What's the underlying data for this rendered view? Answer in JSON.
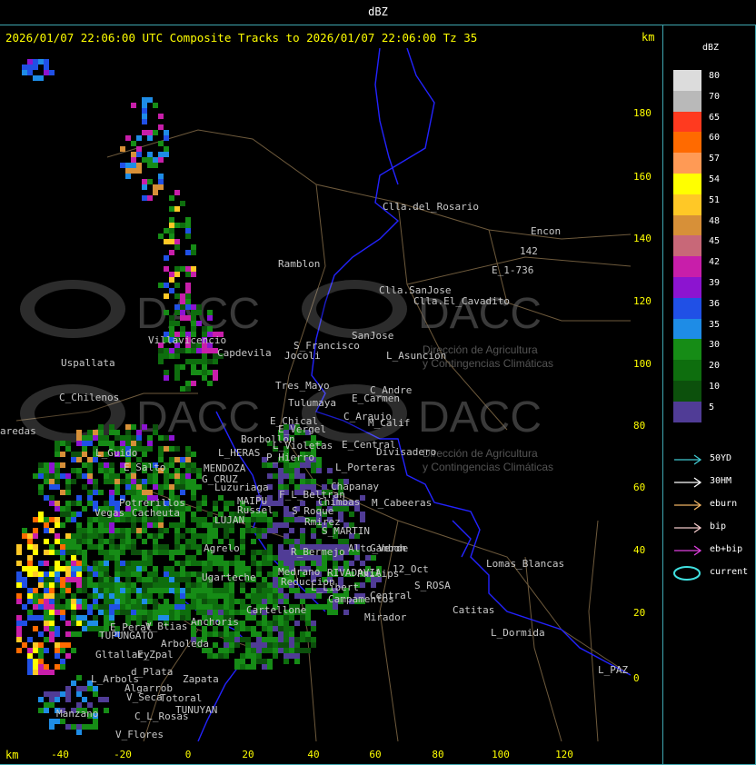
{
  "window": {
    "title": "dBZ"
  },
  "header": {
    "line": "2026/01/07 22:06:00 UTC Composite Tracks to 2026/01/07 22:06:00 Tz 35",
    "km_label_top": "km",
    "km_label_bottom": "km"
  },
  "axes": {
    "y_ticks": [
      "180",
      "160",
      "140",
      "120",
      "100",
      "80",
      "60",
      "40",
      "20",
      "0"
    ],
    "x_ticks": [
      "-40",
      "-20",
      "0",
      "20",
      "40",
      "60",
      "80",
      "100",
      "120"
    ]
  },
  "places": [
    {
      "name": "Clla.del_Rosario"
    },
    {
      "name": "Encon"
    },
    {
      "name": "E_1-736"
    },
    {
      "name": "142"
    },
    {
      "name": "Ramblon"
    },
    {
      "name": "Clla.SanJose"
    },
    {
      "name": "Clla.El_Cavadito"
    },
    {
      "name": "Villavicencio"
    },
    {
      "name": "Capdevila"
    },
    {
      "name": "S_Francisco"
    },
    {
      "name": "SanJose"
    },
    {
      "name": "L_Asuncion"
    },
    {
      "name": "Uspallata"
    },
    {
      "name": "Jocoli"
    },
    {
      "name": "Tres_Mayo"
    },
    {
      "name": "C_Andre"
    },
    {
      "name": "E_Carmen"
    },
    {
      "name": "C_Chilenos"
    },
    {
      "name": "Tulumaya"
    },
    {
      "name": "C_Araujo"
    },
    {
      "name": "M_Calif"
    },
    {
      "name": "aredas"
    },
    {
      "name": "E_Chical"
    },
    {
      "name": "E_Vergel"
    },
    {
      "name": "Borbollon"
    },
    {
      "name": "L_Violetas"
    },
    {
      "name": "E_Central"
    },
    {
      "name": "Divisadero"
    },
    {
      "name": "L_Guido"
    },
    {
      "name": "L_HERAS"
    },
    {
      "name": "P_Hierro"
    },
    {
      "name": "E_Salto"
    },
    {
      "name": "MENDOZA"
    },
    {
      "name": "L_Porteras"
    },
    {
      "name": "G_CRUZ"
    },
    {
      "name": "Chapanay"
    },
    {
      "name": "Luzuriaga"
    },
    {
      "name": "F_L_Beltran"
    },
    {
      "name": "Potrerillos"
    },
    {
      "name": "MAIPU"
    },
    {
      "name": "Russel"
    },
    {
      "name": "Chimbas"
    },
    {
      "name": "M_Cabeeras"
    },
    {
      "name": "Vegas"
    },
    {
      "name": "Cacheuta"
    },
    {
      "name": "LUJAN"
    },
    {
      "name": "S_Roque"
    },
    {
      "name": "Rmirez"
    },
    {
      "name": "S_MARTIN"
    },
    {
      "name": "Agrelo"
    },
    {
      "name": "R_Bermejo"
    },
    {
      "name": "Alto_Verde"
    },
    {
      "name": "Gambon"
    },
    {
      "name": "Lomas_Blancas"
    },
    {
      "name": "Ugarteche"
    },
    {
      "name": "RIVADAVIA"
    },
    {
      "name": "Philips"
    },
    {
      "name": "12_Oct"
    },
    {
      "name": "S_ROSA"
    },
    {
      "name": "Medrano"
    },
    {
      "name": "Reduccion"
    },
    {
      "name": "L_Libert"
    },
    {
      "name": "Central"
    },
    {
      "name": "Campamentos"
    },
    {
      "name": "Cartellone"
    },
    {
      "name": "Catitas"
    },
    {
      "name": "Anchoris"
    },
    {
      "name": "E_Peral"
    },
    {
      "name": "V_Btias"
    },
    {
      "name": "TUPUNGATO"
    },
    {
      "name": "Mirador"
    },
    {
      "name": "L_Dormida"
    },
    {
      "name": "Arboleda"
    },
    {
      "name": "Gltallary"
    },
    {
      "name": "E_Zpal"
    },
    {
      "name": "L_Arbols"
    },
    {
      "name": "d_Plata"
    },
    {
      "name": "Zapata"
    },
    {
      "name": "L_PAZ"
    },
    {
      "name": "Algarrob"
    },
    {
      "name": "V_Seca"
    },
    {
      "name": "Totoral"
    },
    {
      "name": "TUNUYAN"
    },
    {
      "name": "Manzano"
    },
    {
      "name": "C_L_Rosas"
    },
    {
      "name": "V_Flores"
    }
  ],
  "watermark": {
    "brand": "DACC",
    "line1": "Dirección de Agricultura",
    "line2": "y Contingencias Climáticas"
  },
  "legend": {
    "title": "dBZ",
    "scale": [
      {
        "label": "80",
        "color": "#dcdcdc"
      },
      {
        "label": "70",
        "color": "#b9b9b9"
      },
      {
        "label": "65",
        "color": "#ff3a1f"
      },
      {
        "label": "60",
        "color": "#ff6a00"
      },
      {
        "label": "57",
        "color": "#ff9a55"
      },
      {
        "label": "54",
        "color": "#ffff00"
      },
      {
        "label": "51",
        "color": "#ffc826"
      },
      {
        "label": "48",
        "color": "#d79038"
      },
      {
        "label": "45",
        "color": "#c86878"
      },
      {
        "label": "42",
        "color": "#c81eaa"
      },
      {
        "label": "39",
        "color": "#8c14d0"
      },
      {
        "label": "36",
        "color": "#2050e6"
      },
      {
        "label": "35",
        "color": "#1e8ce6"
      },
      {
        "label": "30",
        "color": "#168c16"
      },
      {
        "label": "20",
        "color": "#0e6e0e"
      },
      {
        "label": "10",
        "color": "#0c500c"
      },
      {
        "label": "5",
        "color": "#503c96"
      }
    ],
    "tracks": [
      {
        "label": "50YD",
        "color": "#40c8d0"
      },
      {
        "label": "30HM",
        "color": "#ffffff"
      },
      {
        "label": "eburn",
        "color": "#f0b464"
      },
      {
        "label": "bip",
        "color": "#f0c8c8"
      },
      {
        "label": "eb+bip",
        "color": "#e040e0"
      },
      {
        "label": "current",
        "color": "#40e0e0"
      }
    ]
  },
  "colors": {
    "frame": "#3fa7b0",
    "axis_text": "#ffff00",
    "province_border": "#1e1eff",
    "road": "#6e5a3c",
    "place_text": "#c8c8c8"
  }
}
